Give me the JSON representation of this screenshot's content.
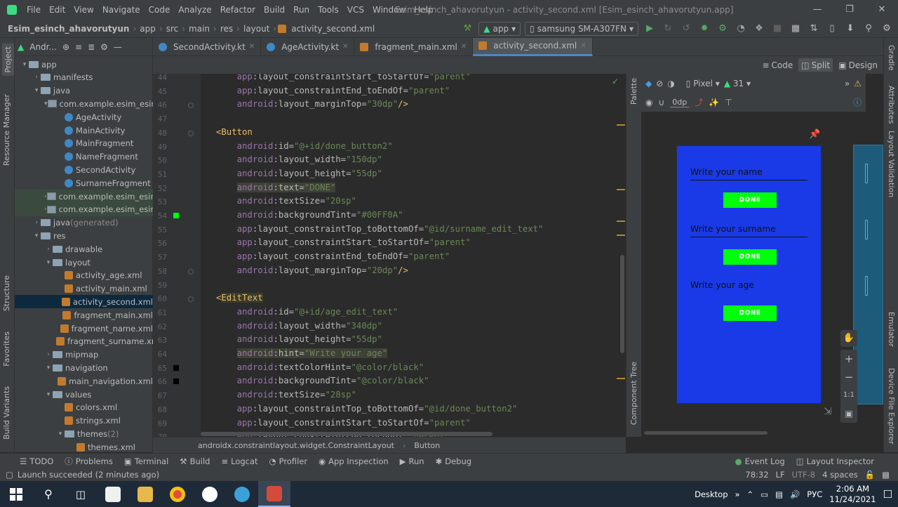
{
  "menu": [
    "File",
    "Edit",
    "View",
    "Navigate",
    "Code",
    "Analyze",
    "Refactor",
    "Build",
    "Run",
    "Tools",
    "VCS",
    "Window",
    "Help"
  ],
  "window_title": "Esim_esinch_ahavorutyun - activity_second.xml [Esim_esinch_ahavorutyun.app]",
  "breadcrumb": [
    "Esim_esinch_ahavorutyun",
    "app",
    "src",
    "main",
    "res",
    "layout",
    "activity_second.xml"
  ],
  "run_config": "app",
  "device": "samsung SM-A307FN",
  "left_strip": [
    "Project",
    "Resource Manager",
    "Structure",
    "Favorites",
    "Build Variants"
  ],
  "right_strip": [
    "Gradle",
    "Attributes",
    "Layout Validation",
    "Emulator",
    "Device File Explorer"
  ],
  "project_view": "Andr...",
  "tree": [
    {
      "label": "app",
      "indent": 0,
      "icon": "folder",
      "arrow": "down"
    },
    {
      "label": "manifests",
      "indent": 1,
      "icon": "folder",
      "arrow": "right"
    },
    {
      "label": "java",
      "indent": 1,
      "icon": "folder",
      "arrow": "down"
    },
    {
      "label": "com.example.esim_esinch",
      "indent": 2,
      "icon": "pkg",
      "arrow": "down"
    },
    {
      "label": "AgeActivity",
      "indent": 3,
      "icon": "class"
    },
    {
      "label": "MainActivity",
      "indent": 3,
      "icon": "class"
    },
    {
      "label": "MainFragment",
      "indent": 3,
      "icon": "class"
    },
    {
      "label": "NameFragment",
      "indent": 3,
      "icon": "class"
    },
    {
      "label": "SecondActivity",
      "indent": 3,
      "icon": "class"
    },
    {
      "label": "SurnameFragment",
      "indent": 3,
      "icon": "class"
    },
    {
      "label": "com.example.esim_esinch",
      "indent": 2,
      "icon": "pkg",
      "arrow": "right",
      "hl": true
    },
    {
      "label": "com.example.esim_esinch",
      "indent": 2,
      "icon": "pkg",
      "arrow": "right",
      "hl": true
    },
    {
      "label": "java",
      "suffix": " (generated)",
      "indent": 1,
      "icon": "folder",
      "arrow": "right"
    },
    {
      "label": "res",
      "indent": 1,
      "icon": "folder",
      "arrow": "down"
    },
    {
      "label": "drawable",
      "indent": 2,
      "icon": "folder",
      "arrow": "right"
    },
    {
      "label": "layout",
      "indent": 2,
      "icon": "folder",
      "arrow": "down"
    },
    {
      "label": "activity_age.xml",
      "indent": 3,
      "icon": "xml"
    },
    {
      "label": "activity_main.xml",
      "indent": 3,
      "icon": "xml"
    },
    {
      "label": "activity_second.xml",
      "indent": 3,
      "icon": "xml",
      "sel": true
    },
    {
      "label": "fragment_main.xml",
      "indent": 3,
      "icon": "xml"
    },
    {
      "label": "fragment_name.xml",
      "indent": 3,
      "icon": "xml"
    },
    {
      "label": "fragment_surname.xm",
      "indent": 3,
      "icon": "xml"
    },
    {
      "label": "mipmap",
      "indent": 2,
      "icon": "folder",
      "arrow": "right"
    },
    {
      "label": "navigation",
      "indent": 2,
      "icon": "folder",
      "arrow": "down"
    },
    {
      "label": "main_navigation.xml",
      "indent": 3,
      "icon": "xml"
    },
    {
      "label": "values",
      "indent": 2,
      "icon": "folder",
      "arrow": "down"
    },
    {
      "label": "colors.xml",
      "indent": 3,
      "icon": "xml"
    },
    {
      "label": "strings.xml",
      "indent": 3,
      "icon": "xml"
    },
    {
      "label": "themes",
      "suffix": " (2)",
      "indent": 3,
      "icon": "folder",
      "arrow": "down"
    },
    {
      "label": "themes.xml",
      "indent": 4,
      "icon": "xml"
    }
  ],
  "tabs": [
    {
      "label": "SecondActivity.kt",
      "active": false
    },
    {
      "label": "AgeActivity.kt",
      "active": false
    },
    {
      "label": "fragment_main.xml",
      "active": false
    },
    {
      "label": "activity_second.xml",
      "active": true
    }
  ],
  "view_modes": [
    "Code",
    "Split",
    "Design"
  ],
  "code_lines": [
    {
      "n": "44",
      "html": "    <span class=\"ns\">app</span><span class=\"at\">:layout_constraintStart_toStartOf=</span><span class=\"st\">\"parent\"</span>"
    },
    {
      "n": "45",
      "html": "    <span class=\"ns\">app</span><span class=\"at\">:layout_constraintEnd_toEndOf=</span><span class=\"st\">\"parent\"</span>"
    },
    {
      "n": "46",
      "html": "    <span class=\"ns\">android</span><span class=\"at\">:layout_marginTop=</span><span class=\"st\">\"30dp\"</span><span class=\"tg\">/></span>"
    },
    {
      "n": "47",
      "html": ""
    },
    {
      "n": "48",
      "html": "<span class=\"tg\">&lt;Button</span>"
    },
    {
      "n": "49",
      "html": "    <span class=\"ns\">android</span><span class=\"at\">:id=</span><span class=\"st\">\"@+id/done_button2\"</span>"
    },
    {
      "n": "50",
      "html": "    <span class=\"ns\">android</span><span class=\"at\">:layout_width=</span><span class=\"st\">\"150dp\"</span>"
    },
    {
      "n": "51",
      "html": "    <span class=\"ns\">android</span><span class=\"at\">:layout_height=</span><span class=\"st\">\"55dp\"</span>"
    },
    {
      "n": "52",
      "html": "    <span class=\"hlbox\"><span class=\"ns\">android</span><span class=\"at\">:text=</span><span class=\"st\">\"DONE\"</span></span>"
    },
    {
      "n": "53",
      "html": "    <span class=\"ns\">android</span><span class=\"at\">:textSize=</span><span class=\"st\">\"20sp\"</span>"
    },
    {
      "n": "54",
      "html": "    <span class=\"ns\">android</span><span class=\"at\">:backgroundTint=</span><span class=\"st\">\"#00FF0A\"</span>"
    },
    {
      "n": "55",
      "html": "    <span class=\"ns\">app</span><span class=\"at\">:layout_constraintTop_toBottomOf=</span><span class=\"st\">\"@id/surname_edit_text\"</span>"
    },
    {
      "n": "56",
      "html": "    <span class=\"ns\">app</span><span class=\"at\">:layout_constraintStart_toStartOf=</span><span class=\"st\">\"parent\"</span>"
    },
    {
      "n": "57",
      "html": "    <span class=\"ns\">app</span><span class=\"at\">:layout_constraintEnd_toEndOf=</span><span class=\"st\">\"parent\"</span>"
    },
    {
      "n": "58",
      "html": "    <span class=\"ns\">android</span><span class=\"at\">:layout_marginTop=</span><span class=\"st\">\"20dp\"</span><span class=\"tg\">/></span>"
    },
    {
      "n": "59",
      "html": ""
    },
    {
      "n": "60",
      "html": "<span class=\"tg\">&lt;</span><span class=\"tg tgh\">EditText</span>"
    },
    {
      "n": "61",
      "html": "    <span class=\"ns\">android</span><span class=\"at\">:id=</span><span class=\"st\">\"@+id/age_edit_text\"</span>"
    },
    {
      "n": "62",
      "html": "    <span class=\"ns\">android</span><span class=\"at\">:layout_width=</span><span class=\"st\">\"340dp\"</span>"
    },
    {
      "n": "63",
      "html": "    <span class=\"ns\">android</span><span class=\"at\">:layout_height=</span><span class=\"st\">\"55dp\"</span>"
    },
    {
      "n": "64",
      "html": "    <span class=\"hlbox\"><span class=\"ns\">android</span><span class=\"at\">:hint=</span><span class=\"st\">\"Write your age\"</span></span>"
    },
    {
      "n": "65",
      "html": "    <span class=\"ns\">android</span><span class=\"at\">:textColorHint=</span><span class=\"st\">\"@color/black\"</span>"
    },
    {
      "n": "66",
      "html": "    <span class=\"ns\">android</span><span class=\"at\">:backgroundTint=</span><span class=\"st\">\"@color/black\"</span>"
    },
    {
      "n": "67",
      "html": "    <span class=\"ns\">android</span><span class=\"at\">:textSize=</span><span class=\"st\">\"28sp\"</span>"
    },
    {
      "n": "68",
      "html": "    <span class=\"ns\">app</span><span class=\"at\">:layout_constraintTop_toBottomOf=</span><span class=\"st\">\"@id/done_button2\"</span>"
    },
    {
      "n": "69",
      "html": "    <span class=\"ns\">app</span><span class=\"at\">:layout_constraintStart_toStartOf=</span><span class=\"st\">\"parent\"</span>"
    },
    {
      "n": "70",
      "html": "    <span class=\"ns\">app</span><span class=\"at\">:layout_constraintEnd_toEndOf=</span><span class=\"st\">\"parent\"</span>"
    }
  ],
  "gutter_colors": {
    "54": "#00ff0a",
    "65": "#000000",
    "66": "#000000"
  },
  "editor_breadcrumb": [
    "androidx.constraintlayout.widget.ConstraintLayout",
    "Button"
  ],
  "design_toolbar": {
    "device": "Pixel",
    "api": "31",
    "margin": "0dp"
  },
  "phone": {
    "bg": "#1a3ae8",
    "fields": [
      {
        "label": "Write your name",
        "underline": true
      },
      {
        "label": "Write your surname",
        "underline": true
      },
      {
        "label": "Write your age",
        "underline": false
      }
    ],
    "button_label": "DONE",
    "button_color": "#00ff0a"
  },
  "palette_label": "Palette",
  "component_tree_label": "Component Tree",
  "bottom_tools": [
    "TODO",
    "Problems",
    "Terminal",
    "Build",
    "Logcat",
    "Profiler",
    "App Inspection",
    "Run",
    "Debug"
  ],
  "bottom_right_tools": [
    "Event Log",
    "Layout Inspector"
  ],
  "status": {
    "message": "Launch succeeded (2 minutes ago)",
    "position": "78:32",
    "line_sep": "LF",
    "encoding": "UTF-8",
    "indent": "4 spaces"
  },
  "taskbar": {
    "desktop": "Desktop",
    "lang": "РУС",
    "time": "2:06 AM",
    "date": "11/24/2021"
  }
}
